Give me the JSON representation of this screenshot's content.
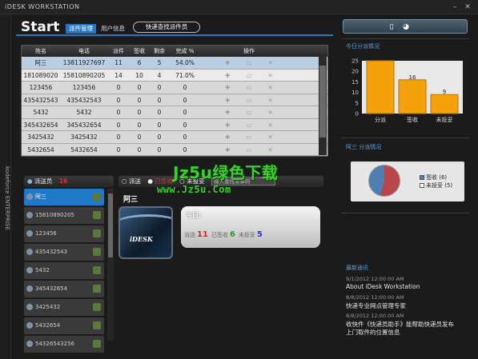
{
  "window": {
    "title": "iDESK WORKSTATION"
  },
  "side_text": "kodeforce ENTERPRISE",
  "header": {
    "start": "Start",
    "tabs": [
      "派件管理",
      "用户信息"
    ],
    "search_button": "快递查找派件员"
  },
  "grid": {
    "columns": [
      "姓名",
      "电话",
      "派件",
      "签收",
      "剩余",
      "完成 %",
      "操作"
    ],
    "rows": [
      [
        "阿三",
        "13811927697",
        "11",
        "6",
        "5",
        "54.0%"
      ],
      [
        "181089020",
        "15810890205",
        "14",
        "10",
        "4",
        "71.0%"
      ],
      [
        "123456",
        "123456",
        "0",
        "0",
        "0",
        "0"
      ],
      [
        "435432543",
        "435432543",
        "0",
        "0",
        "0",
        "0"
      ],
      [
        "5432",
        "5432",
        "0",
        "0",
        "0",
        "0"
      ],
      [
        "345432654",
        "345432654",
        "0",
        "0",
        "0",
        "0"
      ],
      [
        "3425432",
        "3425432",
        "0",
        "0",
        "0",
        "0"
      ],
      [
        "5432654",
        "5432654",
        "0",
        "0",
        "0",
        "0"
      ]
    ]
  },
  "couriers": {
    "label": "派送员",
    "count": "16",
    "items": [
      "阿三",
      "15810890205",
      "123456",
      "435432543",
      "5432",
      "345432654",
      "3425432",
      "5432654",
      "54326543256"
    ]
  },
  "filters": {
    "options": [
      "派送",
      "已签收",
      "未投妥"
    ],
    "search_placeholder": "输入查找派单码"
  },
  "selected": {
    "name": "阿三",
    "photo_text": "iDESK"
  },
  "today": {
    "label": "今日:",
    "items": [
      {
        "label": "派送",
        "value": "11",
        "color": "#e02020"
      },
      {
        "label": "已签收",
        "value": "6",
        "color": "#2a9a2a"
      },
      {
        "label": "未投妥",
        "value": "5",
        "color": "#2040d0"
      }
    ]
  },
  "right": {
    "dist_title": "今日分派情况",
    "bar": {
      "labels": [
        "分派",
        "签收",
        "未投妥"
      ],
      "values": [
        "25",
        "16",
        "9"
      ],
      "ticks": [
        "25",
        "20",
        "15",
        "10",
        "5",
        "0"
      ]
    },
    "pie_title": "阿三 分派情况",
    "pie_legend": [
      "签收 (6)",
      "未投妥 (5)"
    ],
    "news_title": "最新通讯",
    "news": [
      {
        "date": "9/1/2012 12:00:00 AM",
        "text": "About iDesk Workstation"
      },
      {
        "date": "8/8/2012 12:00:00 AM",
        "text": "快递专业网点管理专家"
      },
      {
        "date": "8/8/2012 12:00:00 AM",
        "text": "收快件《快递员助手》能帮助快递员发布",
        "text2": "上门取件的位置信息"
      }
    ]
  },
  "chart_data": {
    "type": "bar",
    "title": "今日分派情况",
    "categories": [
      "分派",
      "签收",
      "未投妥"
    ],
    "values": [
      25,
      16,
      9
    ],
    "ylim": [
      0,
      25
    ]
  },
  "watermark": {
    "line1": "Jz5u绿色下载",
    "line2": "www.Jz5u.Com"
  }
}
